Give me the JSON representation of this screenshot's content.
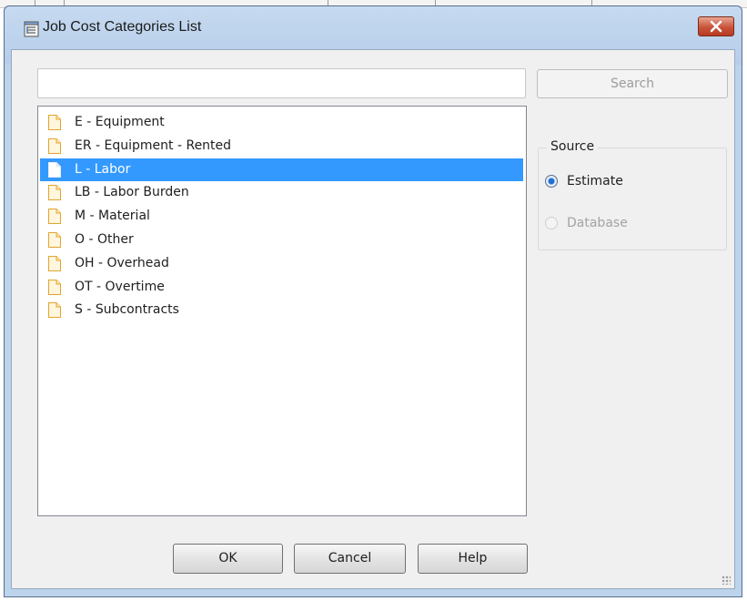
{
  "window": {
    "title": "Job Cost Categories List"
  },
  "search": {
    "value": "",
    "placeholder": "",
    "button_label": "Search"
  },
  "categories": [
    {
      "label": "E - Equipment",
      "selected": false
    },
    {
      "label": "ER - Equipment - Rented",
      "selected": false
    },
    {
      "label": "L - Labor",
      "selected": true
    },
    {
      "label": "LB - Labor Burden",
      "selected": false
    },
    {
      "label": "M - Material",
      "selected": false
    },
    {
      "label": "O - Other",
      "selected": false
    },
    {
      "label": "OH - Overhead",
      "selected": false
    },
    {
      "label": "OT - Overtime",
      "selected": false
    },
    {
      "label": "S - Subcontracts",
      "selected": false
    }
  ],
  "source": {
    "label": "Source",
    "options": [
      {
        "label": "Estimate",
        "checked": true,
        "enabled": true
      },
      {
        "label": "Database",
        "checked": false,
        "enabled": false
      }
    ]
  },
  "buttons": {
    "ok": "OK",
    "cancel": "Cancel",
    "help": "Help"
  },
  "colors": {
    "selection": "#3399ff",
    "title_bar": "#bcd3ec",
    "close_button": "#c8533b",
    "document_icon": "#f0b43c"
  },
  "icons": {
    "window": "list-window-icon",
    "close": "close-x-icon",
    "item": "document-icon",
    "resize": "resize-grip-icon"
  }
}
